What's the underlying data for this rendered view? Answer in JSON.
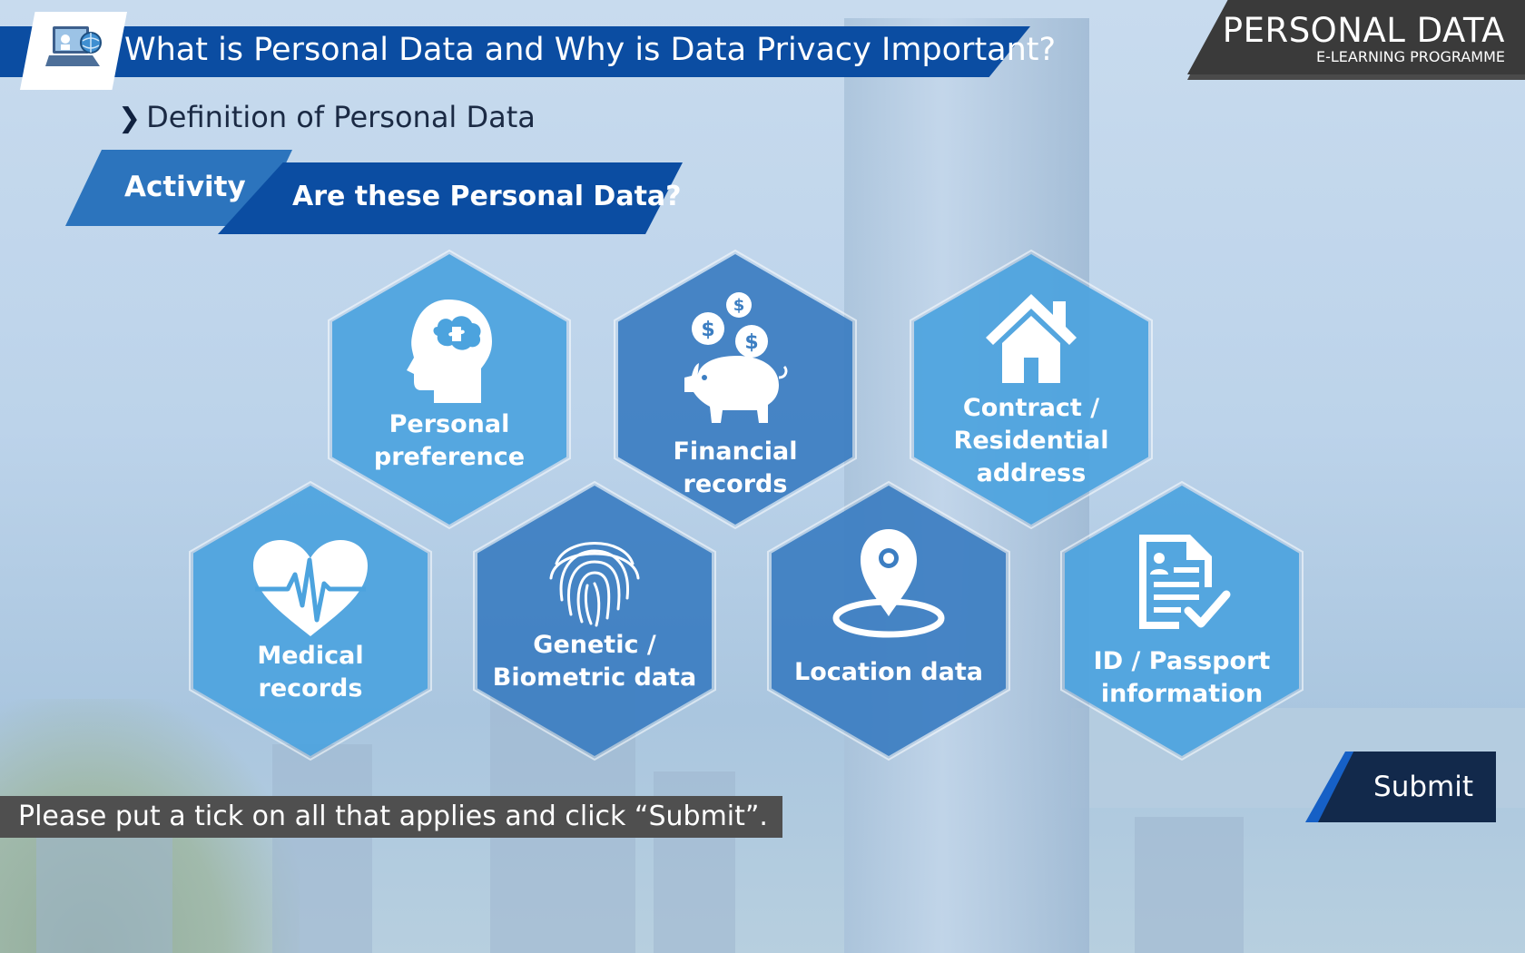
{
  "header": {
    "title": "What is Personal Data and Why is Data Privacy Important?",
    "logo_icon": "laptop-globe-icon"
  },
  "brand": {
    "title": "PERSONAL DATA",
    "subtitle": "E-LEARNING PROGRAMME"
  },
  "section": {
    "chevron": "❯",
    "title": "Definition of Personal Data"
  },
  "activity": {
    "label": "Activity",
    "question": "Are these Personal Data?"
  },
  "options": [
    {
      "label_lines": [
        "Personal",
        "preference"
      ],
      "icon": "head-puzzle-icon",
      "shade": "light"
    },
    {
      "label_lines": [
        "Financial",
        "records"
      ],
      "icon": "piggy-bank-icon",
      "shade": "dark"
    },
    {
      "label_lines": [
        "Contract /",
        "Residential",
        "address"
      ],
      "icon": "house-icon",
      "shade": "light"
    },
    {
      "label_lines": [
        "Medical",
        "records"
      ],
      "icon": "heart-pulse-icon",
      "shade": "light"
    },
    {
      "label_lines": [
        "Genetic /",
        "Biometric data"
      ],
      "icon": "fingerprint-icon",
      "shade": "dark"
    },
    {
      "label_lines": [
        "Location data"
      ],
      "icon": "location-pin-icon",
      "shade": "dark"
    },
    {
      "label_lines": [
        "ID / Passport",
        "information"
      ],
      "icon": "id-document-check-icon",
      "shade": "light"
    }
  ],
  "instruction": "Please put a tick on all that applies and click “Submit”.",
  "submit_label": "Submit",
  "colors": {
    "banner_blue": "#0b4da2",
    "activity_blue": "#2c74bd",
    "hex_light": "#4ca3de",
    "hex_dark": "#3c7ec2",
    "brand_gray": "#4a4a4a",
    "submit_navy": "#12294b"
  }
}
